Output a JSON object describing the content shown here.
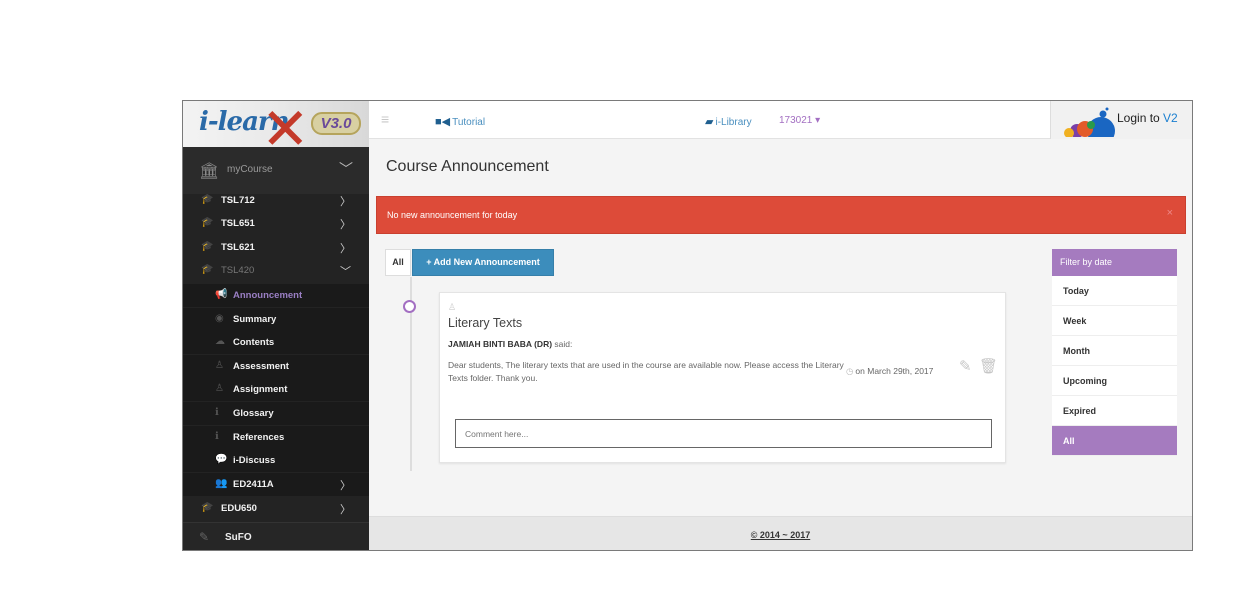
{
  "brand": {
    "logo_text": "i-learn",
    "version": "V3.0"
  },
  "sidebar": {
    "main": {
      "label": "myCourse",
      "icon": "bank-icon"
    },
    "items": [
      {
        "label": "TSL712",
        "level": 1,
        "chevron": "right"
      },
      {
        "label": "TSL651",
        "level": 1,
        "chevron": "right"
      },
      {
        "label": "TSL621",
        "level": 1,
        "chevron": "right"
      },
      {
        "label": "TSL420",
        "level": 1,
        "chevron": "down",
        "dim": true
      },
      {
        "label": "Announcement",
        "level": 2,
        "active": true,
        "icon": "bullhorn-icon"
      },
      {
        "label": "Summary",
        "level": 2,
        "icon": "globe-icon"
      },
      {
        "label": "Contents",
        "level": 2,
        "icon": "cloud-icon"
      },
      {
        "label": "Assessment",
        "level": 2,
        "icon": "user-icon"
      },
      {
        "label": "Assignment",
        "level": 2,
        "icon": "user-icon"
      },
      {
        "label": "Glossary",
        "level": 2,
        "icon": "info-icon"
      },
      {
        "label": "References",
        "level": 2,
        "icon": "info-icon"
      },
      {
        "label": "i-Discuss",
        "level": 2,
        "icon": "chat-icon"
      },
      {
        "label": "ED2411A",
        "level": 2,
        "chevron": "right",
        "icon": "users-icon"
      },
      {
        "label": "EDU650",
        "level": 1,
        "chevron": "right"
      }
    ],
    "sufo": {
      "label": "SuFO",
      "icon": "pencil-icon"
    }
  },
  "topbar": {
    "tutorial": "Tutorial",
    "library": "i-Library",
    "user": "173021",
    "login_prefix": "Login to ",
    "login_version": "V2"
  },
  "main": {
    "title": "Course Announcement",
    "alert": "No new announcement for today",
    "tab_all": "All",
    "add_button": "+ Add New Announcement"
  },
  "announcement": {
    "title": "Literary Texts",
    "author": "JAMIAH BINTI BABA (DR)",
    "said": "said:",
    "body": "Dear students, The literary texts that are used in the course are available now. Please access the Literary Texts folder. Thank you.",
    "date": "on March 29th, 2017",
    "comment_placeholder": "Comment here..."
  },
  "filter": {
    "header": "Filter by date",
    "options": [
      "Today",
      "Week",
      "Month",
      "Upcoming",
      "Expired",
      "All"
    ],
    "selected": "All"
  },
  "footer": {
    "text": "© 2014 ~ 2017"
  },
  "colors": {
    "accent": "#a57bbf",
    "alert": "#dd4b39",
    "primary_button": "#3c8dbc",
    "sidebar_bg": "#232323"
  }
}
